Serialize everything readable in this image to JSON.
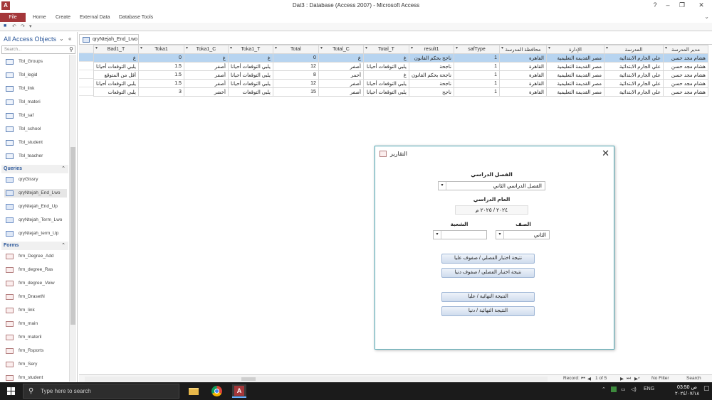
{
  "window": {
    "app_letter": "A",
    "title": "Dat3 : Database (Access 2007) - Microsoft Access",
    "controls": [
      "?",
      "–",
      "❐",
      "✕"
    ]
  },
  "ribbon": {
    "tabs": [
      "File",
      "Home",
      "Create",
      "External Data",
      "Database Tools"
    ]
  },
  "nav": {
    "header": "All Access Objects",
    "search_placeholder": "Search...",
    "tables": [
      "Tbl_Groups",
      "Tbl_legid",
      "Tbl_link",
      "Tbl_materi",
      "Tbl_saf",
      "Tbl_school",
      "Tbl_student",
      "Tbl_teacher"
    ],
    "queries_label": "Queries",
    "queries": [
      "qryGlssry",
      "qryNtejah_End_Lwo",
      "qryNtejah_End_Up",
      "qryNtejah_Term_Lwo",
      "qryNtejah_term_Up"
    ],
    "forms_label": "Forms",
    "forms": [
      "frm_Degree_Add",
      "frm_degree_Ras",
      "frm_degree_Veiw",
      "frm_DrasetN",
      "frm_link",
      "frm_main",
      "frm_materil",
      "frm_Rsports",
      "frm_Sery",
      "frm_student"
    ]
  },
  "doc_tab": {
    "label": "qryNtejah_End_Lwo"
  },
  "datasheet": {
    "columns": [
      "مدير المدرسة",
      "المدرسة",
      "الإدارة",
      "محافظة المدرسة",
      "safType",
      "result1",
      "Total_T",
      "Total_C",
      "Total",
      "Toka1_T",
      "Toka1_C",
      "Toka1",
      "Bad1_T"
    ],
    "rows": [
      [
        "هشام مجد حسن",
        "علي الجارم الابتدائية",
        "مصر القديمة التعليمية",
        "القاهرة",
        "1",
        "ناجح بحكم القانون",
        "غ",
        "غ",
        "0",
        "غ",
        "غ",
        "0",
        "غ"
      ],
      [
        "هشام مجد حسن",
        "علي الجارم الابتدائية",
        "مصر القديمة التعليمية",
        "القاهرة",
        "1",
        "ناجحة",
        "يلبي التوقعات أحيانا",
        "أصفر",
        "12",
        "يلبي التوقعات أحيانا",
        "أصفر",
        "1.5",
        "يلبي التوقعات أحيانا"
      ],
      [
        "هشام مجد حسن",
        "علي الجارم الابتدائية",
        "مصر القديمة التعليمية",
        "القاهرة",
        "1",
        "ناجحة بحكم القانون",
        "غ",
        "أحمر",
        "8",
        "يلبي التوقعات أحيانا",
        "أصفر",
        "1.5",
        "أقل من المتوقع"
      ],
      [
        "هشام مجد حسن",
        "علي الجارم الابتدائية",
        "مصر القديمة التعليمية",
        "القاهرة",
        "1",
        "ناجحة",
        "يلبي التوقعات أحيانا",
        "أصفر",
        "12",
        "يلبي التوقعات أحيانا",
        "أصفر",
        "1.5",
        "يلبي التوقعات أحيانا"
      ],
      [
        "هشام مجد حسن",
        "علي الجارم الابتدائية",
        "مصر القديمة التعليمية",
        "القاهرة",
        "1",
        "ناجح",
        "يلبي التوقعات أحيانا",
        "أصفر",
        "15",
        "يلبي التوقعات",
        "أخضر",
        "3",
        "يلبي التوقعات"
      ]
    ]
  },
  "record_nav": {
    "label": "Record:",
    "position": "1 of 5",
    "filter": "No Filter",
    "search": "Search"
  },
  "dialog": {
    "title": "التقارير",
    "term_label": "الفصل الدراسي",
    "term_value": "الفصل الدراسي الثاني",
    "year_label": "العام الدراسي",
    "year_value": "٢٠٢٤ / ٢٠٢٥ م",
    "grade_label": "الصف",
    "grade_value": "الثاني",
    "class_label": "الشعبة",
    "class_value": "",
    "buttons": [
      "نتيجة اختبار الفصلي / صفوف عليا",
      "نتيجة اختبار الفصلي / صفوف دنيا",
      "النتيجة النهائية / عليا",
      "النتيجة النهائية / دنيا"
    ]
  },
  "taskbar": {
    "search_placeholder": "Type here to search",
    "lang": "ENG",
    "time": "03:50 ص",
    "date": "٢٠٢٤/٠٧/١٨"
  },
  "colors": {
    "access_red": "#a4373a",
    "selection": "#b7d4f0",
    "dialog_border": "#4da6b3"
  }
}
